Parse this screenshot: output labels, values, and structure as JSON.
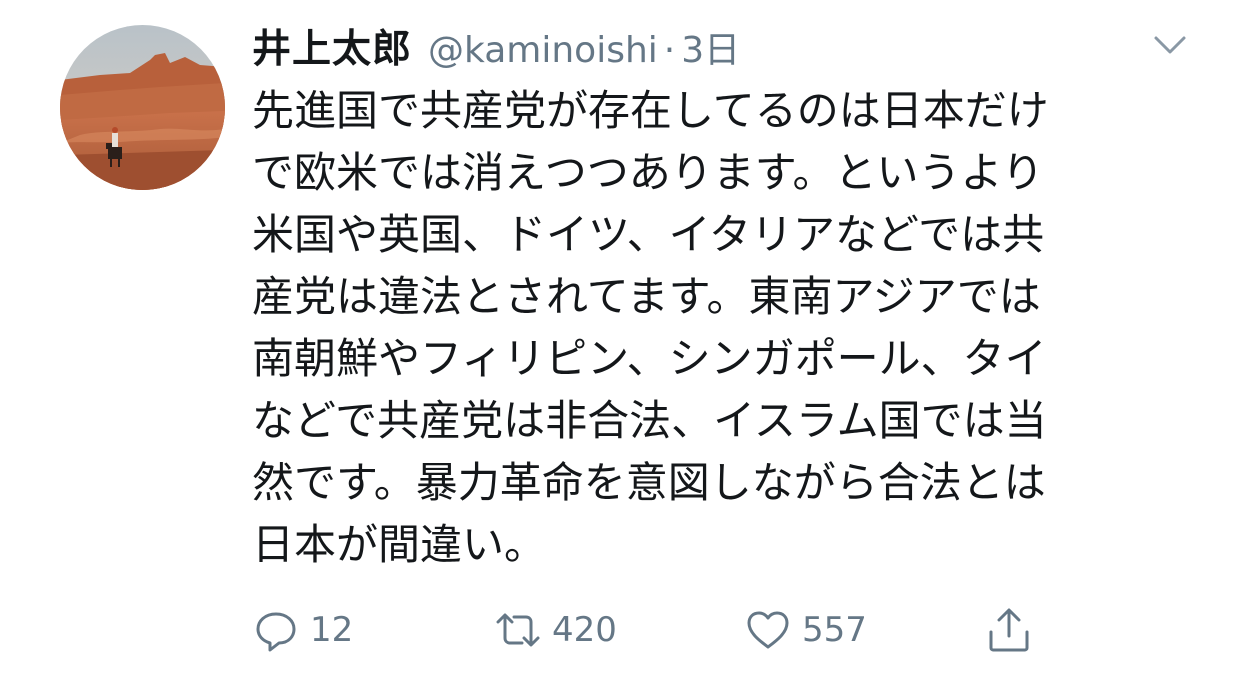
{
  "tweet": {
    "display_name": "井上太郎",
    "handle": "@kaminoishi",
    "separator": "·",
    "time": "3日",
    "text_lines": [
      "先進国で共産党が存在してるのは日本だけ",
      "で欧米では消えつつあります。というより",
      "米国や英国、ドイツ、イタリアなどでは共",
      "産党は違法とされてます。東南アジアでは",
      "南朝鮮やフィリピン、シンガポール、タイ",
      "などで共産党は非合法、イスラム国では当",
      "然です。暴力革命を意図しながら合法とは",
      "日本が間違い。"
    ]
  },
  "actions": {
    "reply": {
      "icon": "reply-icon",
      "count": "12"
    },
    "retweet": {
      "icon": "retweet-icon",
      "count": "420"
    },
    "like": {
      "icon": "heart-icon",
      "count": "557"
    },
    "share": {
      "icon": "share-icon"
    }
  },
  "menu": {
    "icon": "chevron-down-icon"
  },
  "colors": {
    "text_primary": "#14171a",
    "text_secondary": "#657786",
    "background": "#ffffff"
  }
}
